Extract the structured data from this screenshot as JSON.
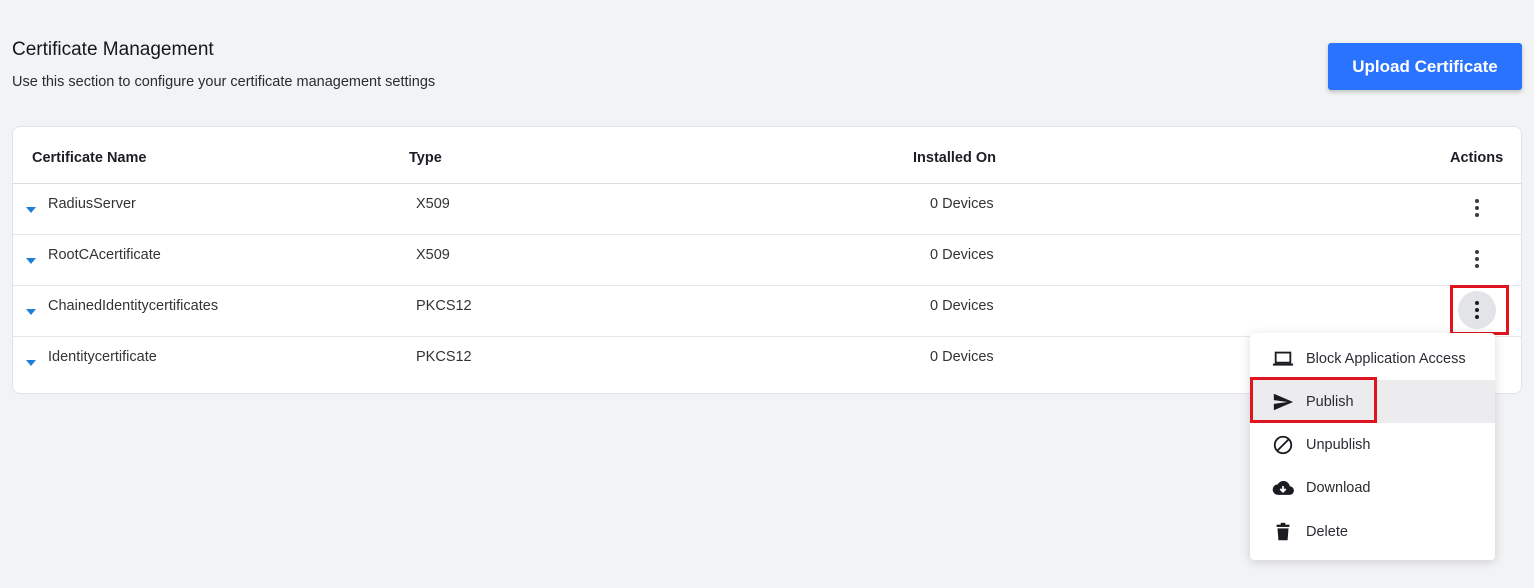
{
  "header": {
    "title": "Certificate Management",
    "subtitle": "Use this section to configure your certificate management settings",
    "upload_button": "Upload Certificate"
  },
  "table": {
    "columns": [
      "Certificate Name",
      "Type",
      "Installed On",
      "Actions"
    ],
    "rows": [
      {
        "name": "RadiusServer",
        "type": "X509",
        "installed": "0 Devices"
      },
      {
        "name": "RootCAcertificate",
        "type": "X509",
        "installed": "0 Devices"
      },
      {
        "name": "ChainedIdentitycertificates",
        "type": "PKCS12",
        "installed": "0 Devices"
      },
      {
        "name": "Identitycertificate",
        "type": "PKCS12",
        "installed": "0 Devices"
      }
    ]
  },
  "actions_menu": {
    "items": [
      {
        "label": "Block Application Access",
        "icon": "laptop-icon"
      },
      {
        "label": "Publish",
        "icon": "send-icon"
      },
      {
        "label": "Unpublish",
        "icon": "block-icon"
      },
      {
        "label": "Download",
        "icon": "cloud-download-icon"
      },
      {
        "label": "Delete",
        "icon": "trash-icon"
      }
    ],
    "selected": "Publish"
  },
  "colors": {
    "accent": "#2a73ff",
    "caret": "#1f7fd6",
    "highlight": "#e0141e"
  }
}
